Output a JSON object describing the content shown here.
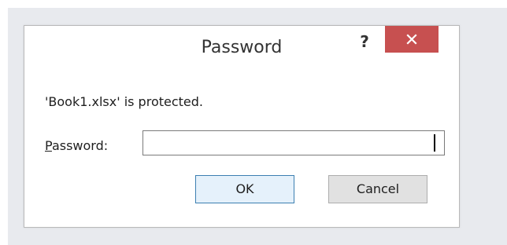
{
  "dialog": {
    "title": "Password",
    "help_symbol": "?",
    "close_icon": "close-icon",
    "message": "'Book1.xlsx' is protected.",
    "password_label_accel": "P",
    "password_label_rest": "assword:",
    "password_value": "",
    "ok_label": "OK",
    "cancel_label": "Cancel",
    "colors": {
      "close_button": "#c75050",
      "ok_border": "#3c7fb1",
      "backdrop": "#e8eaee"
    }
  }
}
